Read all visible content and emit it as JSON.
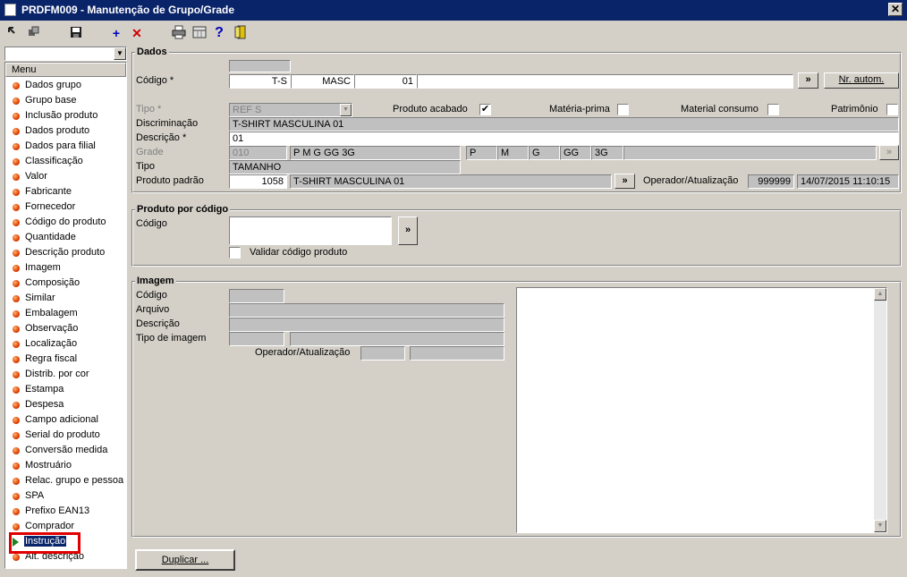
{
  "window": {
    "title": "PRDFM009 - Manutenção de Grupo/Grade",
    "close_glyph": "✕"
  },
  "toolbar": {
    "icons": [
      "back-forward-icon",
      "copy-icon",
      "save-icon",
      "add-icon",
      "delete-icon",
      "print-icon",
      "calculator-icon",
      "help-icon",
      "exit-door-icon"
    ]
  },
  "menu": {
    "header": "Menu",
    "items": [
      "Dados grupo",
      "Grupo base",
      "Inclusão produto",
      "Dados produto",
      "Dados para filial",
      "Classificação",
      "Valor",
      "Fabricante",
      "Fornecedor",
      "Código do produto",
      "Quantidade",
      "Descrição produto",
      "Imagem",
      "Composição",
      "Similar",
      "Embalagem",
      "Observação",
      "Localização",
      "Regra fiscal",
      "Distrib. por cor",
      "Estampa",
      "Despesa",
      "Campo adicional",
      "Serial do produto",
      "Conversão medida",
      "Mostruário",
      "Relac. grupo e pessoa",
      "SPA",
      "Prefixo EAN13",
      "Comprador",
      "Instrução",
      "Alt. descrição"
    ],
    "selected": "Instrução"
  },
  "dados": {
    "title": "Dados",
    "codigo_label": "Código *",
    "codigo_1": "T-S",
    "codigo_2": "MASC",
    "codigo_3": "01",
    "nr_autom": "Nr. autom.",
    "more_glyph": "»",
    "tipo_label": "Tipo *",
    "tipo_value": "REF S",
    "produto_acabado": "Produto acabado",
    "produto_acabado_checked": "✔",
    "materia_prima": "Matéria-prima",
    "material_consumo": "Material consumo",
    "patrimonio": "Patrimônio",
    "discriminacao_label": "Discriminação",
    "discriminacao": "T-SHIRT MASCULINA 01",
    "descricao_label": "Descrição *",
    "descricao": "01",
    "grade_label": "Grade",
    "grade_code": "010",
    "grade_desc": "P M G GG 3G",
    "grade_sizes": [
      "P",
      "M",
      "G",
      "GG",
      "3G"
    ],
    "tipo2_label": "Tipo",
    "tipo2_value": "TAMANHO",
    "produto_padrao_label": "Produto padrão",
    "produto_padrao_code": "1058",
    "produto_padrao_desc": "T-SHIRT MASCULINA 01",
    "operador_label": "Operador/Atualização",
    "operador": "999999",
    "atualizacao": "14/07/2015 11:10:15"
  },
  "produto_codigo": {
    "title": "Produto por código",
    "codigo_label": "Código",
    "validar": "Validar código produto"
  },
  "imagem": {
    "title": "Imagem",
    "codigo_label": "Código",
    "arquivo_label": "Arquivo",
    "descricao_label": "Descrição",
    "tipo_label": "Tipo de imagem",
    "operador_label": "Operador/Atualização",
    "scroll_up": "▲",
    "scroll_down": "▼"
  },
  "duplicar": "Duplicar ..."
}
